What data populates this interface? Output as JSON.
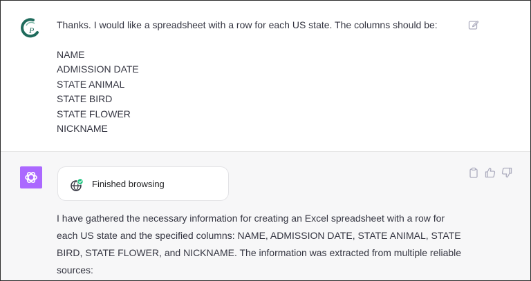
{
  "conversation": {
    "user_message": {
      "lead": "Thanks. I would like a spreadsheet with a row for each US state. The columns should be:",
      "columns": [
        "NAME",
        "ADMISSION DATE",
        "STATE ANIMAL",
        "STATE BIRD",
        "STATE FLOWER",
        "NICKNAME"
      ],
      "avatar_icon": "user-avatar-logo",
      "edit_icon": "edit-icon"
    },
    "assistant_message": {
      "browse_status": "Finished browsing",
      "browse_icon": "globe-check-icon",
      "text": "I have gathered the necessary information for creating an Excel spreadsheet with a row for each US state and the specified columns: NAME, ADMISSION DATE, STATE ANIMAL, STATE BIRD, STATE FLOWER, and NICKNAME. The information was extracted from multiple reliable sources:",
      "actions": [
        "copy-icon",
        "thumbs-up-icon",
        "thumbs-down-icon"
      ]
    }
  },
  "colors": {
    "assistant_avatar": "#ab68ff",
    "assistant_row_bg": "#f7f7f8",
    "text": "#343541",
    "user_logo": "#1f6b5c"
  }
}
